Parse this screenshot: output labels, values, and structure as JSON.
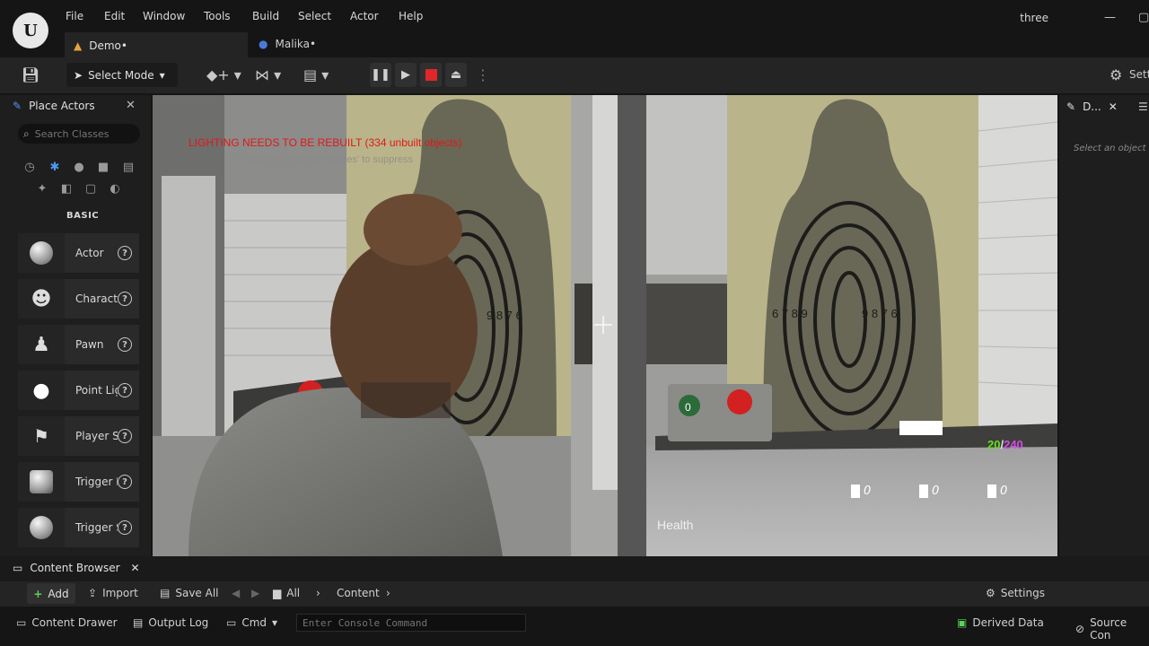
{
  "menubar": {
    "items": [
      "File",
      "Edit",
      "Window",
      "Tools",
      "Build",
      "Select",
      "Actor",
      "Help"
    ],
    "project_name": "three"
  },
  "tabs": [
    {
      "label": "Demo•",
      "icon": "level-icon",
      "color": "#e8a33a"
    },
    {
      "label": "Malika•",
      "icon": "character-icon",
      "color": "#4a7bd4"
    }
  ],
  "toolbar": {
    "select_mode_label": "Select Mode",
    "settings_label": "Settings"
  },
  "place_actors": {
    "title": "Place Actors",
    "search_placeholder": "Search Classes",
    "section_label": "BASIC",
    "items": [
      {
        "label": "Actor"
      },
      {
        "label": "Character"
      },
      {
        "label": "Pawn"
      },
      {
        "label": "Point Light"
      },
      {
        "label": "Player Start"
      },
      {
        "label": "Trigger Box"
      },
      {
        "label": "Trigger Sphere"
      }
    ]
  },
  "viewport": {
    "warning": "LIGHTING NEEDS TO BE REBUILT (334 unbuilt objects)",
    "suppress_hint": "'DisableAllScreenMessages' to suppress",
    "ammo_current": "20",
    "ammo_separator": "/",
    "ammo_total": "240",
    "score_values": [
      "0",
      "0",
      "0"
    ],
    "health_label": "Health",
    "target_numbers_left": "6 7 8 9",
    "target_numbers_right": "9 8 7 6",
    "target_numbers_left2": "9 8 7 6",
    "console_button": "0"
  },
  "details": {
    "title": "D...",
    "hint": "Select an object t"
  },
  "content_browser": {
    "title": "Content Browser",
    "add_label": "Add",
    "import_label": "Import",
    "save_all_label": "Save All",
    "path_all": "All",
    "path_content": "Content",
    "settings_label": "Settings"
  },
  "statusbar": {
    "content_drawer": "Content Drawer",
    "output_log": "Output Log",
    "cmd_label": "Cmd",
    "console_placeholder": "Enter Console Command",
    "derived_data": "Derived Data",
    "source_control": "Source Con"
  }
}
